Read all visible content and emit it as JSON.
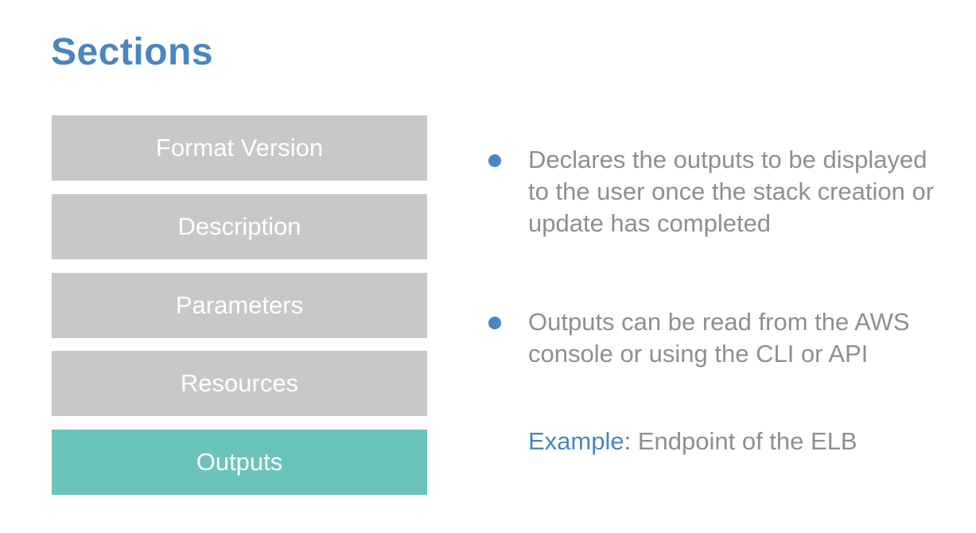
{
  "title": "Sections",
  "sections": [
    {
      "label": "Format Version",
      "active": false
    },
    {
      "label": "Description",
      "active": false
    },
    {
      "label": "Parameters",
      "active": false
    },
    {
      "label": "Resources",
      "active": false
    },
    {
      "label": "Outputs",
      "active": true
    }
  ],
  "bullets": [
    "Declares the outputs to be displayed to the user once the stack creation or update has completed",
    "Outputs can be read from the AWS console or using the CLI or API"
  ],
  "example": {
    "label": "Example",
    "separator": ":",
    "text": " Endpoint of the ELB"
  },
  "colors": {
    "accent": "#4a86c0",
    "box": "#c8c8c8",
    "active_box": "#6bc4b9",
    "text": "#8f8f8f"
  }
}
